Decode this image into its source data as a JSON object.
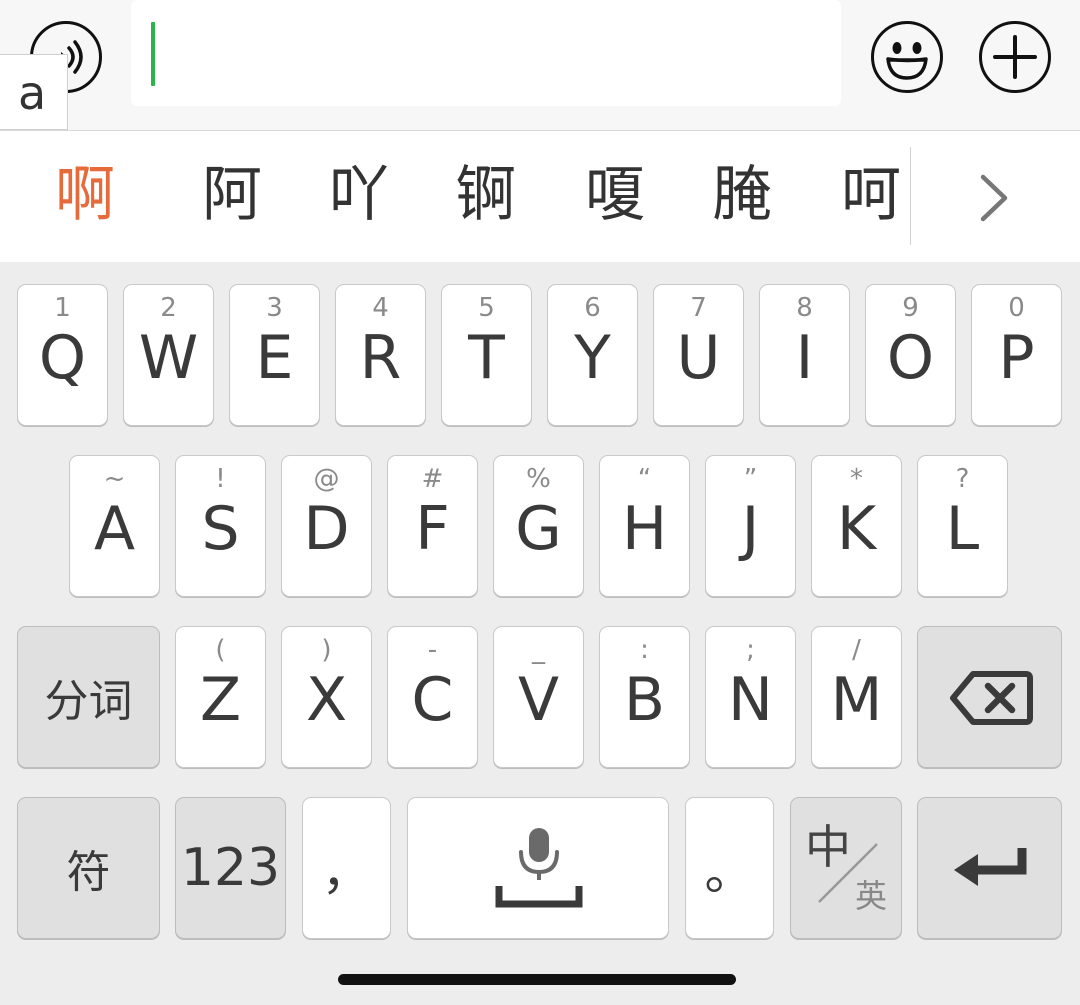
{
  "input_bar": {
    "preedit": "a",
    "text_value": ""
  },
  "candidates": {
    "items": [
      "啊",
      "阿",
      "吖",
      "锕",
      "嗄",
      "腌",
      "呵"
    ],
    "active_index": 0,
    "active_color": "#e76a3b"
  },
  "keyboard": {
    "row1": [
      {
        "main": "Q",
        "hint": "1"
      },
      {
        "main": "W",
        "hint": "2"
      },
      {
        "main": "E",
        "hint": "3"
      },
      {
        "main": "R",
        "hint": "4"
      },
      {
        "main": "T",
        "hint": "5"
      },
      {
        "main": "Y",
        "hint": "6"
      },
      {
        "main": "U",
        "hint": "7"
      },
      {
        "main": "I",
        "hint": "8"
      },
      {
        "main": "O",
        "hint": "9"
      },
      {
        "main": "P",
        "hint": "0"
      }
    ],
    "row2": [
      {
        "main": "A",
        "hint": "~"
      },
      {
        "main": "S",
        "hint": "!"
      },
      {
        "main": "D",
        "hint": "@"
      },
      {
        "main": "F",
        "hint": "#"
      },
      {
        "main": "G",
        "hint": "%"
      },
      {
        "main": "H",
        "hint": "“"
      },
      {
        "main": "J",
        "hint": "”"
      },
      {
        "main": "K",
        "hint": "*"
      },
      {
        "main": "L",
        "hint": "?"
      }
    ],
    "row3": [
      {
        "main": "Z",
        "hint": "("
      },
      {
        "main": "X",
        "hint": ")"
      },
      {
        "main": "C",
        "hint": "-"
      },
      {
        "main": "V",
        "hint": "_"
      },
      {
        "main": "B",
        "hint": ":"
      },
      {
        "main": "N",
        "hint": ";"
      },
      {
        "main": "M",
        "hint": "/"
      }
    ],
    "segment_label": "分词",
    "symbol_label": "符",
    "number_label": "123",
    "comma_label": "，",
    "period_label": "。",
    "lang_main": "中",
    "lang_sub": "英"
  },
  "icons": {
    "voice": "voice-icon",
    "emoji": "emoji-icon",
    "plus": "plus-icon",
    "expand": "chevron-right-icon",
    "backspace": "backspace-icon",
    "microphone": "microphone-icon",
    "enter": "enter-icon"
  },
  "colors": {
    "caret": "#2cb34a",
    "keyboard_bg": "#ededed",
    "key_bg": "#ffffff",
    "function_key_bg": "#e0e0e0"
  }
}
